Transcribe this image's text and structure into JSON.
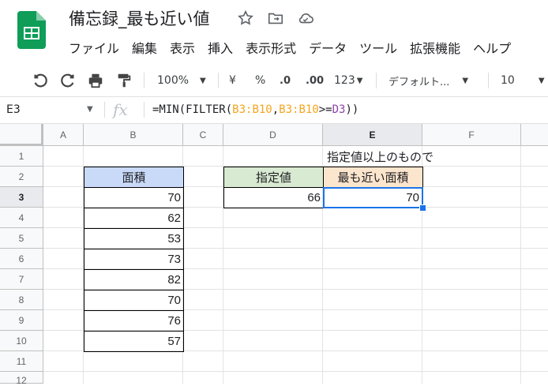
{
  "doc": {
    "title": "備忘録_最も近い値"
  },
  "menu": [
    "ファイル",
    "編集",
    "表示",
    "挿入",
    "表示形式",
    "データ",
    "ツール",
    "拡張機能",
    "ヘルプ"
  ],
  "toolbar": {
    "zoom": "100%",
    "currency": "¥",
    "percent": "%",
    "dec_decrease": ".0",
    "dec_increase": ".00",
    "format_more": "123",
    "font": "デフォルト...",
    "font_size": "10"
  },
  "formula_bar": {
    "cell_ref": "E3",
    "fx": "fx",
    "formula_parts": [
      "=MIN(FILTER(",
      "B3:B10",
      ",",
      "B3:B10",
      ">=",
      "D3",
      "))"
    ]
  },
  "columns": [
    "A",
    "B",
    "C",
    "D",
    "E",
    "F"
  ],
  "rows": [
    "1",
    "2",
    "3",
    "4",
    "5",
    "6",
    "7",
    "8",
    "9",
    "10",
    "11",
    "12"
  ],
  "sheet": {
    "e1_note": "指定値以上のもので",
    "b2_header": "面積",
    "b_values": [
      "70",
      "62",
      "53",
      "73",
      "82",
      "70",
      "76",
      "57"
    ],
    "d2_header": "指定値",
    "d3_value": "66",
    "e2_header": "最も近い面積",
    "e3_value": "70"
  },
  "colors": {
    "header_blue": "#c9daf8",
    "header_green": "#d9ead3",
    "header_orange": "#fce5cd",
    "selection": "#1a73e8",
    "brand_green": "#0f9d58"
  },
  "icons": {
    "logo": "sheets-logo-icon",
    "star": "star-icon",
    "move": "move-folder-icon",
    "cloud": "cloud-status-icon",
    "undo": "undo-icon",
    "redo": "redo-icon",
    "print": "print-icon",
    "paint": "paint-format-icon"
  }
}
